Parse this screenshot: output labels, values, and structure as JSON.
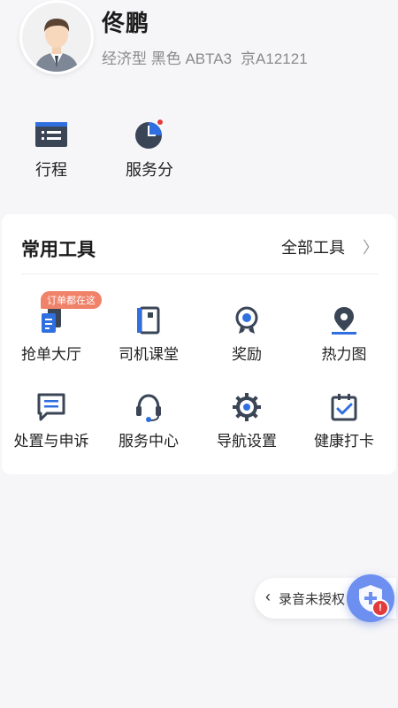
{
  "profile": {
    "name": "佟鹏",
    "vehicle": "经济型 黑色 ABTA3",
    "plate": "京A12121"
  },
  "quick_actions": [
    {
      "label": "行程",
      "icon": "itinerary-icon"
    },
    {
      "label": "服务分",
      "icon": "service-score-icon"
    }
  ],
  "tools": {
    "title": "常用工具",
    "all_label": "全部工具",
    "badge": "订单都在这",
    "items": [
      {
        "label": "抢单大厅",
        "icon": "order-hall-icon"
      },
      {
        "label": "司机课堂",
        "icon": "book-icon"
      },
      {
        "label": "奖励",
        "icon": "medal-icon"
      },
      {
        "label": "热力图",
        "icon": "map-pin-icon"
      },
      {
        "label": "处置与申诉",
        "icon": "message-icon"
      },
      {
        "label": "服务中心",
        "icon": "headset-icon"
      },
      {
        "label": "导航设置",
        "icon": "gear-icon"
      },
      {
        "label": "健康打卡",
        "icon": "calendar-check-icon"
      }
    ]
  },
  "recording": {
    "label": "录音未授权",
    "alert": "!"
  },
  "colors": {
    "icon_dark": "#3a4556",
    "icon_accent": "#2f6fe0",
    "badge": "#f0826a",
    "shield_button": "#6c8ff0",
    "alert": "#e23b3b"
  }
}
